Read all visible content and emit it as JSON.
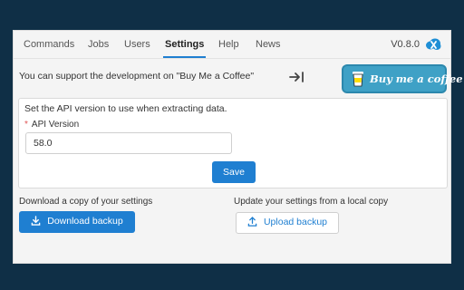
{
  "tabs": [
    {
      "label": "Commands"
    },
    {
      "label": "Jobs"
    },
    {
      "label": "Users"
    },
    {
      "label": "Settings",
      "active": true
    },
    {
      "label": "Help"
    },
    {
      "label": "News"
    }
  ],
  "version": "V0.8.0",
  "support": {
    "text": "You can support the development on \"Buy Me a Coffee\"",
    "button_label": "Buy me a coffee",
    "button_color": "#3fa1c6"
  },
  "api": {
    "description": "Set the API version to use when extracting data.",
    "label": "API Version",
    "required_marker": "*",
    "value": "58.0",
    "save_label": "Save"
  },
  "backup": {
    "download_text": "Download a copy of your settings",
    "download_button": "Download backup",
    "upload_text": "Update your settings from a local copy",
    "upload_button": "Upload backup"
  },
  "colors": {
    "accent": "#1f7fd1",
    "background": "#0f2f46"
  },
  "icons": [
    "cloud-logo-icon",
    "collapse-arrow-icon",
    "coffee-cup-icon",
    "download-icon",
    "upload-icon"
  ]
}
